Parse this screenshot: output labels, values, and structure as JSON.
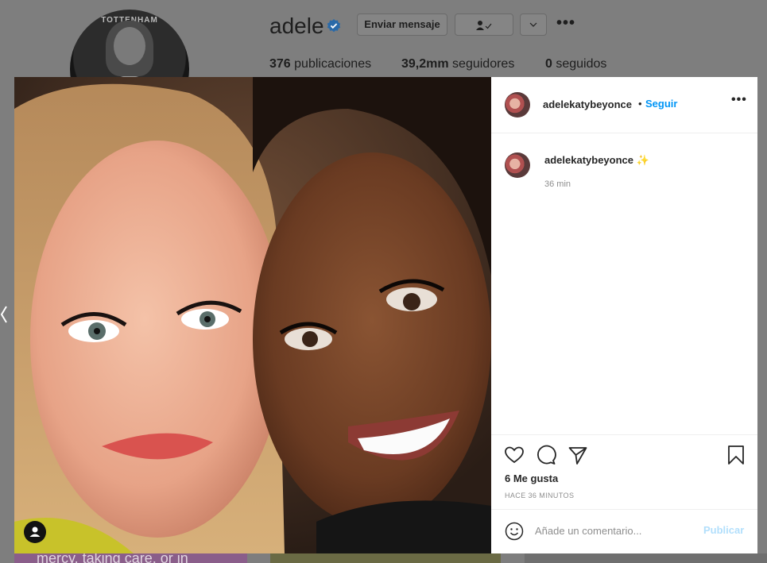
{
  "profile": {
    "username": "adele",
    "message_button": "Enviar mensaje",
    "posts_count": "376",
    "posts_label": " publicaciones",
    "followers_count": "39,2mm",
    "followers_label": " seguidores",
    "following_count": "0",
    "following_label": " seguidos",
    "avatar_banner_text": "TOTTENHAM"
  },
  "grid_tile_text": "mercy, taking care, or in",
  "post": {
    "author": "adelekatybeyonce",
    "follow_separator": "•",
    "follow_label": "Seguir",
    "more_label": "•••",
    "caption_user": "adelekatybeyonce",
    "caption_emoji": "✨",
    "caption_time": "36 min",
    "likes_text": "6 Me gusta",
    "date_text": "HACE 36 MINUTOS",
    "comment_placeholder": "Añade un comentario...",
    "publish_label": "Publicar"
  },
  "colors": {
    "link_blue": "#0095f6",
    "publish_disabled": "#b2dffc",
    "verified_blue": "#3897f0",
    "overlay_dim": "#7e7e7e"
  },
  "icons": [
    "verified-badge-icon",
    "person-check-icon",
    "chevron-down-icon",
    "more-dots-icon",
    "heart-icon",
    "comment-icon",
    "share-icon",
    "bookmark-icon",
    "emoji-icon",
    "tag-user-icon",
    "chevron-left-icon"
  ]
}
